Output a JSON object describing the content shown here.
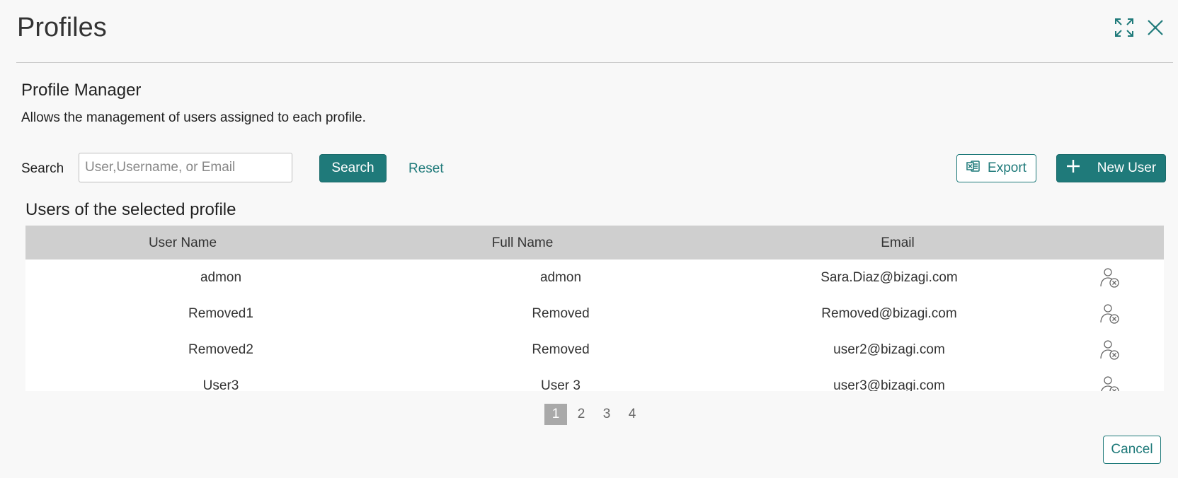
{
  "dialog": {
    "title": "Profiles",
    "maximize_icon": "expand-icon",
    "close_icon": "close-icon"
  },
  "manager": {
    "title": "Profile Manager",
    "description": "Allows the management of users assigned to each profile."
  },
  "search": {
    "label": "Search",
    "placeholder": "User,Username, or Email",
    "value": "",
    "button_label": "Search",
    "reset_label": "Reset"
  },
  "actions": {
    "export_label": "Export",
    "export_icon": "excel-icon",
    "new_user_label": "New User",
    "new_user_icon": "plus-icon"
  },
  "table": {
    "title": "Users of the selected profile",
    "columns": [
      "User Name",
      "Full Name",
      "Email"
    ],
    "rows": [
      {
        "user": "admon",
        "full": "admon",
        "email": "Sara.Diaz@bizagi.com"
      },
      {
        "user": "Removed1",
        "full": "Removed",
        "email": "Removed@bizagi.com"
      },
      {
        "user": "Removed2",
        "full": "Removed",
        "email": "user2@bizagi.com"
      },
      {
        "user": "User3",
        "full": "User 3",
        "email": "user3@bizagi.com"
      }
    ],
    "row_action_icon": "remove-user-icon"
  },
  "pagination": {
    "pages": [
      "1",
      "2",
      "3",
      "4"
    ],
    "current": "1"
  },
  "footer": {
    "cancel_label": "Cancel"
  },
  "colors": {
    "accent": "#1f7a7a",
    "header_bg": "#cfcfcf",
    "active_page": "#a9a9a9"
  }
}
